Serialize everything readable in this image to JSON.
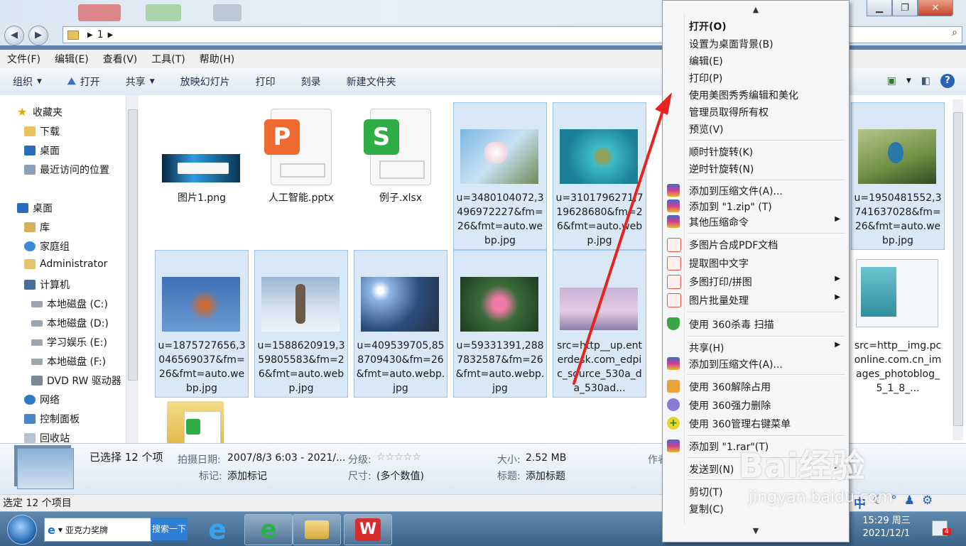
{
  "address": {
    "path": "1"
  },
  "menubar": [
    "文件(F)",
    "编辑(E)",
    "查看(V)",
    "工具(T)",
    "帮助(H)"
  ],
  "toolbar": {
    "organize": "组织",
    "open": "打开",
    "share": "共享",
    "slideshow": "放映幻灯片",
    "print": "打印",
    "burn": "刻录",
    "new_folder": "新建文件夹"
  },
  "nav": {
    "favorites": "收藏夹",
    "downloads": "下载",
    "desktop_fav": "桌面",
    "recent": "最近访问的位置",
    "desktop": "桌面",
    "libraries": "库",
    "homegroup": "家庭组",
    "admin": "Administrator",
    "computer": "计算机",
    "drive_c": "本地磁盘 (C:)",
    "drive_d": "本地磁盘 (D:)",
    "drive_e": "学习娱乐 (E:)",
    "drive_f": "本地磁盘 (F:)",
    "dvd": "DVD RW 驱动器",
    "network": "网络",
    "control": "控制面板",
    "recycle": "回收站"
  },
  "files": [
    {
      "name": "图片1.png"
    },
    {
      "name": "人工智能.pptx"
    },
    {
      "name": "例子.xlsx"
    },
    {
      "name": "u=3480104072,3496972227&fm=26&fmt=auto.webp.jpg"
    },
    {
      "name": "u=3101796271,719628680&fm=26&fmt=auto.webp.jpg"
    },
    {
      "name": "u=1950481552,3741637028&fm=26&fmt=auto.webp.jpg"
    },
    {
      "name": "u=1875727656,3046569037&fm=26&fmt=auto.webp.jpg"
    },
    {
      "name": "u=1588620919,359805583&fm=26&fmt=auto.webp.jpg"
    },
    {
      "name": "u=409539705,858709430&fm=26&fmt=auto.webp.jpg"
    },
    {
      "name": "u=59331391,2887832587&fm=26&fmt=auto.webp.jpg"
    },
    {
      "name": "src=http__up.enterdesk.com_edpic_source_530a_da_530ad..."
    },
    {
      "name": "src=http__img.pconline.com.cn_images_photoblog_5_1_8_..."
    }
  ],
  "details": {
    "selected": "已选择 12 个项",
    "date_label": "拍摄日期:",
    "date_value": "2007/8/3 6:03 - 2021/...",
    "rating_label": "分级:",
    "size_label": "大小:",
    "size_value": "2.52 MB",
    "tag_label": "标记:",
    "tag_value": "添加标记",
    "dim_label": "尺寸:",
    "dim_value": "(多个数值)",
    "title_label": "标题:",
    "title_value": "添加标题",
    "author_label": "作者"
  },
  "status": "选定 12 个项目",
  "taskbar": {
    "search_text": "亚克力奖牌",
    "search_button": "搜索一下",
    "clock_time": "15:29 周三",
    "clock_date": "2021/12/1",
    "notif_count": "4"
  },
  "context_menu": {
    "open": "打开(O)",
    "set_bg": "设置为桌面背景(B)",
    "edit": "编辑(E)",
    "print": "打印(P)",
    "meitu": "使用美图秀秀编辑和美化",
    "owner": "管理员取得所有权",
    "preview": "预览(V)",
    "rot_cw": "顺时针旋转(K)",
    "rot_ccw": "逆时针旋转(N)",
    "add_archive": "添加到压缩文件(A)...",
    "add_zip": "添加到 \"1.zip\" (T)",
    "other_compress": "其他压缩命令",
    "pdf": "多图片合成PDF文档",
    "ocr": "提取图中文字",
    "multi_print": "多图打印/拼图",
    "batch": "图片批量处理",
    "scan360": "使用 360杀毒 扫描",
    "share": "共享(H)",
    "add_archive2": "添加到压缩文件(A)...",
    "unlock360": "使用 360解除占用",
    "del360": "使用 360强力删除",
    "manage360": "使用 360管理右键菜单",
    "add_rar": "添加到 \"1.rar\"(T)",
    "send_to": "发送到(N)",
    "cut": "剪切(T)",
    "copy": "复制(C)"
  },
  "watermark": {
    "brand": "Bai经验",
    "url": "jingyan.baidu.com"
  }
}
